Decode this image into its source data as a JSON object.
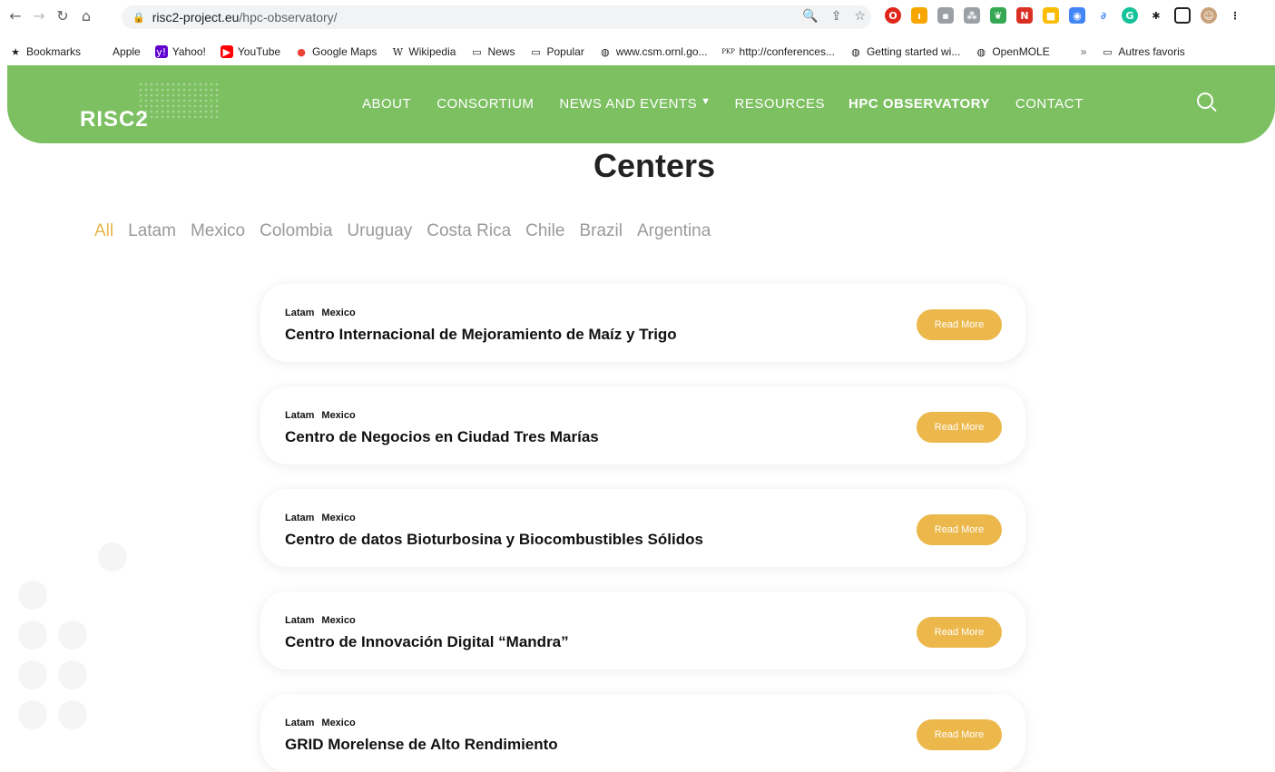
{
  "browser": {
    "url_host": "risc2-project.eu",
    "url_path": "/hpc-observatory/",
    "bookmarks": [
      {
        "label": "Bookmarks",
        "icon": "star-icon"
      },
      {
        "label": "Apple",
        "icon": "apple-icon"
      },
      {
        "label": "Yahoo!",
        "icon": "yahoo-icon"
      },
      {
        "label": "YouTube",
        "icon": "youtube-icon"
      },
      {
        "label": "Google Maps",
        "icon": "maps-icon"
      },
      {
        "label": "Wikipedia",
        "icon": "wikipedia-icon"
      },
      {
        "label": "News",
        "icon": "folder-icon"
      },
      {
        "label": "Popular",
        "icon": "folder-icon"
      },
      {
        "label": "www.csm.ornl.go...",
        "icon": "globe-icon"
      },
      {
        "label": "http://conferences...",
        "icon": "pkp-icon"
      },
      {
        "label": "Getting started wi...",
        "icon": "globe-icon"
      },
      {
        "label": "OpenMOLE",
        "icon": "globe-icon"
      },
      {
        "label": "Autres favoris",
        "icon": "folder-icon"
      }
    ],
    "more_bookmarks": "»"
  },
  "site": {
    "logo": "RISC2",
    "nav": [
      {
        "label": "ABOUT"
      },
      {
        "label": "CONSORTIUM"
      },
      {
        "label": "NEWS AND EVENTS"
      },
      {
        "label": "RESOURCES"
      },
      {
        "label": "HPC OBSERVATORY"
      },
      {
        "label": "CONTACT"
      }
    ]
  },
  "page": {
    "title": "Centers",
    "filters": [
      "All",
      "Latam",
      "Mexico",
      "Colombia",
      "Uruguay",
      "Costa Rica",
      "Chile",
      "Brazil",
      "Argentina"
    ],
    "cards": [
      {
        "tag1": "Latam",
        "tag2": "Mexico",
        "title": "Centro Internacional de Mejoramiento de Maíz y Trigo",
        "button": "Read More"
      },
      {
        "tag1": "Latam",
        "tag2": "Mexico",
        "title": "Centro de Negocios en Ciudad Tres Marías",
        "button": "Read More"
      },
      {
        "tag1": "Latam",
        "tag2": "Mexico",
        "title": "Centro de datos Bioturbosina y Biocombustibles Sólidos",
        "button": "Read More"
      },
      {
        "tag1": "Latam",
        "tag2": "Mexico",
        "title": "Centro de Innovación Digital “Mandra”",
        "button": "Read More"
      },
      {
        "tag1": "Latam",
        "tag2": "Mexico",
        "title": "GRID Morelense de Alto Rendimiento",
        "button": "Read More"
      }
    ]
  },
  "colors": {
    "header_green": "#7dc062",
    "accent_gold": "#ecb84c",
    "active_filter": "#e8b54a"
  }
}
